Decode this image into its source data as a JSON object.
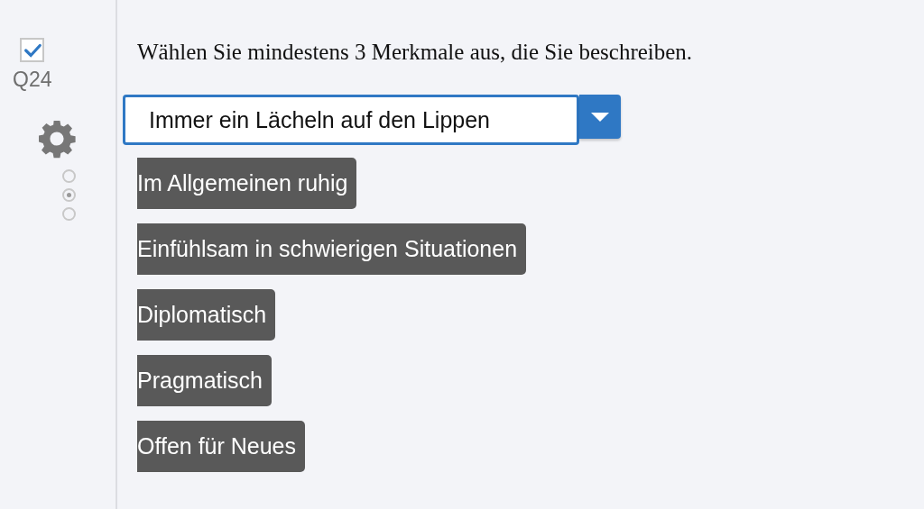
{
  "sidebar": {
    "checked": true,
    "question_number": "Q24",
    "pager": [
      {
        "selected": false
      },
      {
        "selected": true
      },
      {
        "selected": false
      }
    ]
  },
  "question": {
    "text": "Wählen Sie mindestens 3 Merkmale aus, die Sie beschreiben.",
    "dropdown": {
      "value": "Immer ein Lächeln auf den Lippen"
    },
    "choices": [
      "Im Allgemeinen ruhig",
      "Einfühlsam in schwierigen Situationen",
      "Diplomatisch",
      "Pragmatisch",
      "Offen für Neues"
    ]
  }
}
